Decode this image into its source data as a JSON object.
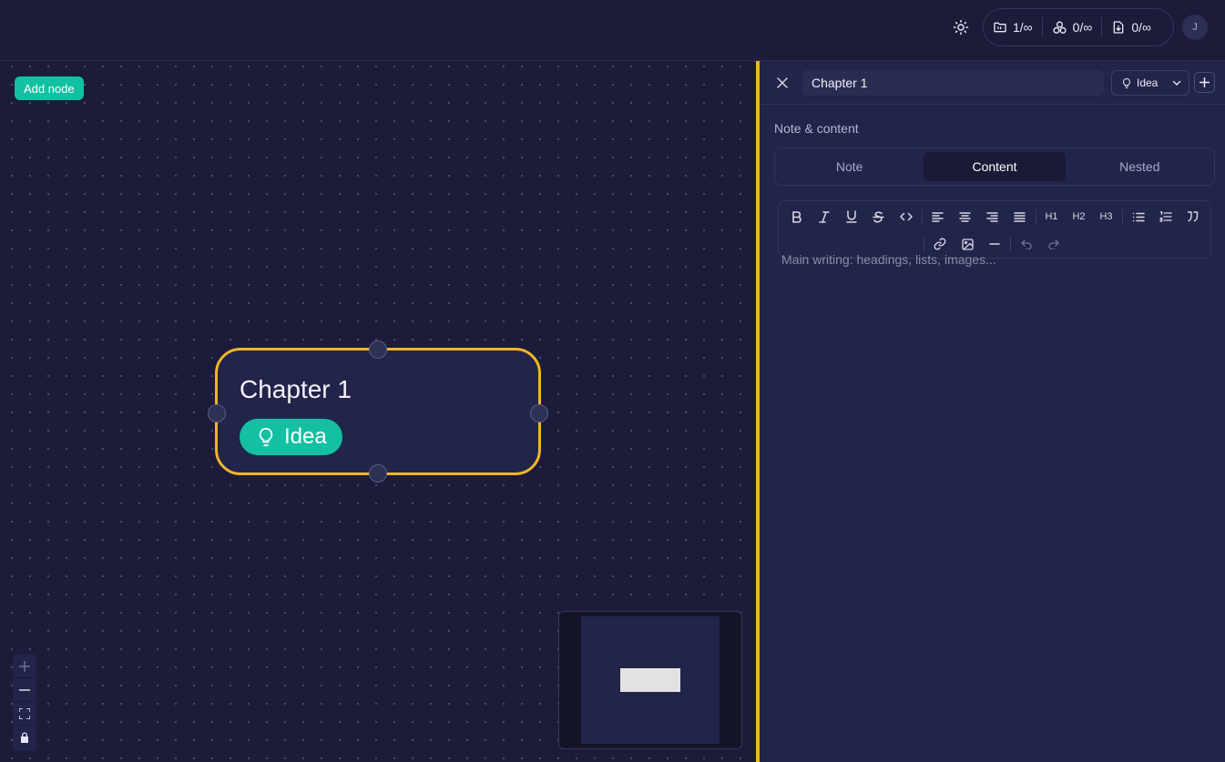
{
  "topbar": {
    "usage": [
      {
        "icon": "folder-icon",
        "value": "1/∞"
      },
      {
        "icon": "nodes-icon",
        "value": "0/∞"
      },
      {
        "icon": "file-download-icon",
        "value": "0/∞"
      }
    ],
    "avatar_initial": "J"
  },
  "canvas": {
    "add_node_label": "Add node",
    "node": {
      "title": "Chapter 1",
      "tag": "Idea",
      "tag_icon": "lightbulb-icon",
      "selected_border_color": "#f0b429",
      "tag_color": "#13c0a2"
    },
    "controls": [
      "zoom-in-icon",
      "zoom-out-icon",
      "fit-view-icon",
      "lock-icon"
    ]
  },
  "panel": {
    "title_value": "Chapter 1",
    "type_select": "Idea",
    "section_label": "Note & content",
    "tabs": [
      "Note",
      "Content",
      "Nested"
    ],
    "active_tab": "Content",
    "toolbar": {
      "heading1": "H1",
      "heading2": "H2",
      "heading3": "H3"
    },
    "editor_placeholder": "Main writing: headings, lists, images..."
  },
  "colors": {
    "background": "#1c1c3a",
    "panel": "#22244a",
    "accent": "#13c0a2",
    "selection": "#f0b429"
  }
}
